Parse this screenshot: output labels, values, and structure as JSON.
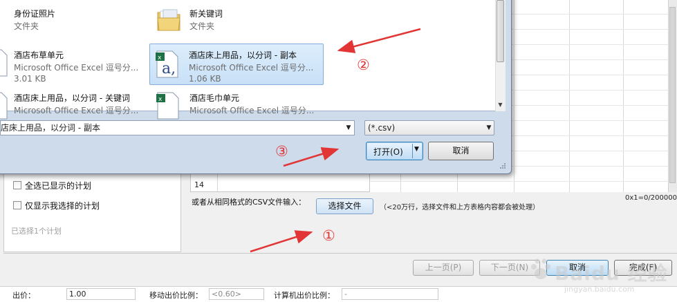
{
  "dialog": {
    "files": [
      {
        "name": "身份证照片",
        "type": "文件夹",
        "size": "",
        "icon": "folder-dark-icon"
      },
      {
        "name": "新关键词",
        "type": "文件夹",
        "size": "",
        "icon": "folder-icon"
      },
      {
        "name": "酒店布草单元",
        "type": "Microsoft Office Excel 逗号分...",
        "size": "3.01 KB",
        "icon": "excel-csv-icon"
      },
      {
        "name": "酒店床上用品，以分词 - 副本",
        "type": "Microsoft Office Excel 逗号分...",
        "size": "1.06 KB",
        "icon": "excel-csv-icon",
        "selected": true
      },
      {
        "name": "酒店床上用品，以分词 - 关键词",
        "type": "Microsoft Office Excel 逗号分...",
        "size": "",
        "icon": "excel-csv-icon"
      },
      {
        "name": "酒店毛巾单元",
        "type": "Microsoft Office Excel 逗号分...",
        "size": "",
        "icon": "excel-csv-icon"
      }
    ],
    "filename": "店床上用品，以分词 - 副本",
    "filetype": "(*.csv)",
    "open_label": "打开(O)",
    "cancel_label": "取消"
  },
  "wizard": {
    "row_number": "14",
    "ratio": "0x1=0/200000",
    "options": [
      {
        "label": "全选已显示的计划",
        "checked": false
      },
      {
        "label": "仅显示我选择的计划",
        "checked": false
      }
    ],
    "selected_count": "已选择1个计划",
    "import_label": "或者从相同格式的CSV文件输入：",
    "select_file_label": "选择文件",
    "import_note": "（<20万行，选择文件和上方表格内容都会被处理）",
    "buttons": {
      "prev": "上一页(P)",
      "next": "下一页(N)",
      "cancel": "取消",
      "finish": "完成(F)"
    }
  },
  "bottom": {
    "bid_label": "出价：",
    "bid_value": "1.00",
    "mobile_label": "移动出价比例：",
    "mobile_value": "<0.60>",
    "pc_label": "计算机出价比例：",
    "pc_value": "-"
  },
  "annotations": [
    "①",
    "②",
    "③"
  ],
  "watermark": {
    "text": "Baidu 经验",
    "url": "jingyan.baidu.com"
  },
  "colors": {
    "accent": "#3c7fb1",
    "annotation": "#e23535",
    "selection": "#c8e0f7"
  }
}
